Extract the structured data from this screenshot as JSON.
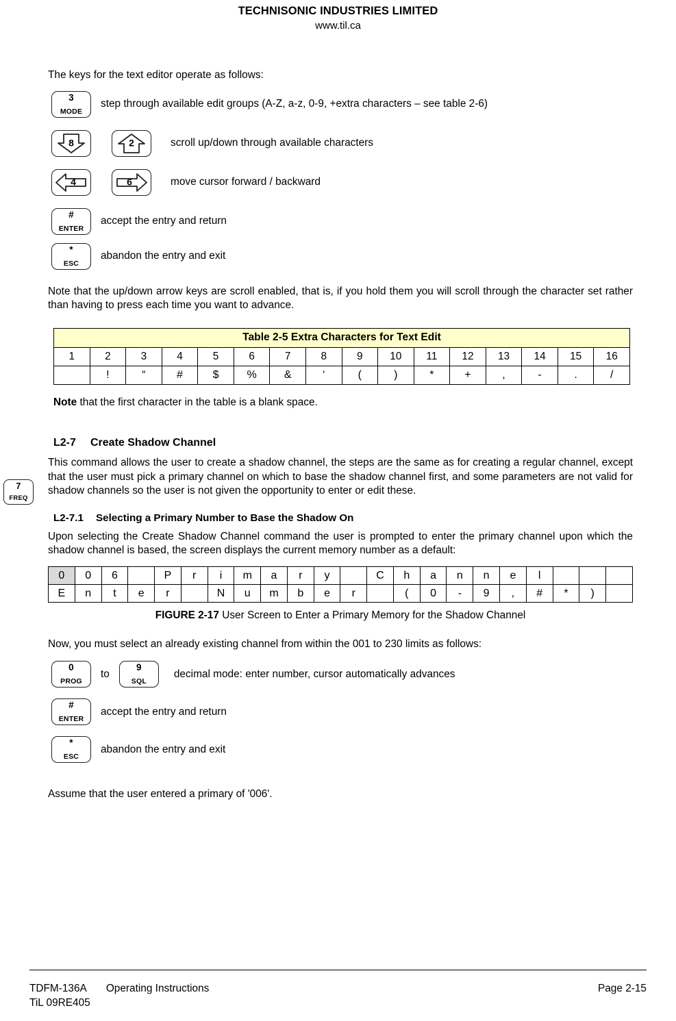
{
  "header": {
    "company": "TECHNISONIC INDUSTRIES LIMITED",
    "website": "www.til.ca"
  },
  "intro": {
    "lead": "The keys for the text editor operate as follows:"
  },
  "editor_keys": [
    {
      "key_top": "3",
      "key_bottom": "MODE",
      "description": "step through available edit groups (A-Z, a-z, 0-9, +extra characters – see table 2-6)"
    },
    {
      "key_top": "8",
      "key_bottom": "",
      "key2_top": "2",
      "key2_bottom": "",
      "description": "scroll up/down through available characters"
    },
    {
      "key_top": "4",
      "key_bottom": "",
      "key2_top": "6",
      "key2_bottom": "",
      "description": "move cursor forward / backward"
    },
    {
      "key_top": "#",
      "key_bottom": "ENTER",
      "description": "accept the entry and return"
    },
    {
      "key_top": "*",
      "key_bottom": "ESC",
      "description": "abandon the entry and exit"
    }
  ],
  "scroll_note": "Note that the up/down arrow keys are scroll enabled, that is, if you hold them you will scroll through the character set rather than having to press each time you want to advance.",
  "table_2_5": {
    "title": "Table 2-5 Extra Characters for Text Edit",
    "indices": [
      "1",
      "2",
      "3",
      "4",
      "5",
      "6",
      "7",
      "8",
      "9",
      "10",
      "11",
      "12",
      "13",
      "14",
      "15",
      "16"
    ],
    "characters": [
      "",
      "!",
      "“",
      "#",
      "$",
      "%",
      "&",
      "‘",
      "(",
      ")",
      "*",
      "+",
      ",",
      "-",
      ".",
      "/"
    ]
  },
  "blank_note": {
    "bold": "Note",
    "rest": " that the first character in the table is a blank space."
  },
  "margin_key": {
    "key_top": "7",
    "key_bottom": "FREQ"
  },
  "section_l2_7": {
    "number": "L2-7",
    "title": "Create Shadow Channel",
    "body": "This command allows the user to create a shadow channel, the steps are the same as for creating a regular channel, except that the user must pick a primary channel on which to base the shadow channel first, and some parameters are not valid for shadow channels so the user is not given the opportunity to enter or edit these."
  },
  "section_l2_7_1": {
    "number": "L2-7.1",
    "title": "Selecting a Primary Number to Base the Shadow On",
    "body": "Upon selecting the Create Shadow Channel command the user is prompted to enter the primary channel upon which the shadow channel is based, the screen displays the current memory number as a default:"
  },
  "screen_grid": {
    "columns": 22,
    "highlight_cell": {
      "row": 0,
      "col": 0
    },
    "rows": [
      [
        "0",
        "0",
        "6",
        "",
        "P",
        "r",
        "i",
        "m",
        "a",
        "r",
        "y",
        "",
        "C",
        "h",
        "a",
        "n",
        "n",
        "e",
        "l",
        "",
        "",
        ""
      ],
      [
        "E",
        "n",
        "t",
        "e",
        "r",
        "",
        "N",
        "u",
        "m",
        "b",
        "e",
        "r",
        "",
        "(",
        "0",
        "-",
        "9",
        ",",
        "#",
        "*",
        ")",
        ""
      ]
    ]
  },
  "figure": {
    "label": "FIGURE 2-17",
    "caption": " User Screen to Enter a Primary Memory for the Shadow Channel"
  },
  "select_prompt": "Now, you must select an already existing channel from within the 001 to 230 limits as follows:",
  "entry_keys": [
    {
      "key_top": "0",
      "key_bottom": "PROG",
      "connector": "to",
      "key2_top": "9",
      "key2_bottom": "SQL",
      "description": "decimal mode: enter number, cursor automatically advances"
    },
    {
      "key_top": "#",
      "key_bottom": "ENTER",
      "description": "accept the entry and return"
    },
    {
      "key_top": "*",
      "key_bottom": "ESC",
      "description": "abandon the entry and exit"
    }
  ],
  "assume_line": "Assume that the user entered a primary of '006'.",
  "footer": {
    "doc_number": "TDFM-136A",
    "doc_kind": "Operating Instructions",
    "revision": "TiL 09RE405",
    "page": "Page 2-15"
  },
  "colors": {
    "table_header_bg": "#ffffcc",
    "cursor_highlight": "#d9d9d9",
    "text": "#000000"
  }
}
